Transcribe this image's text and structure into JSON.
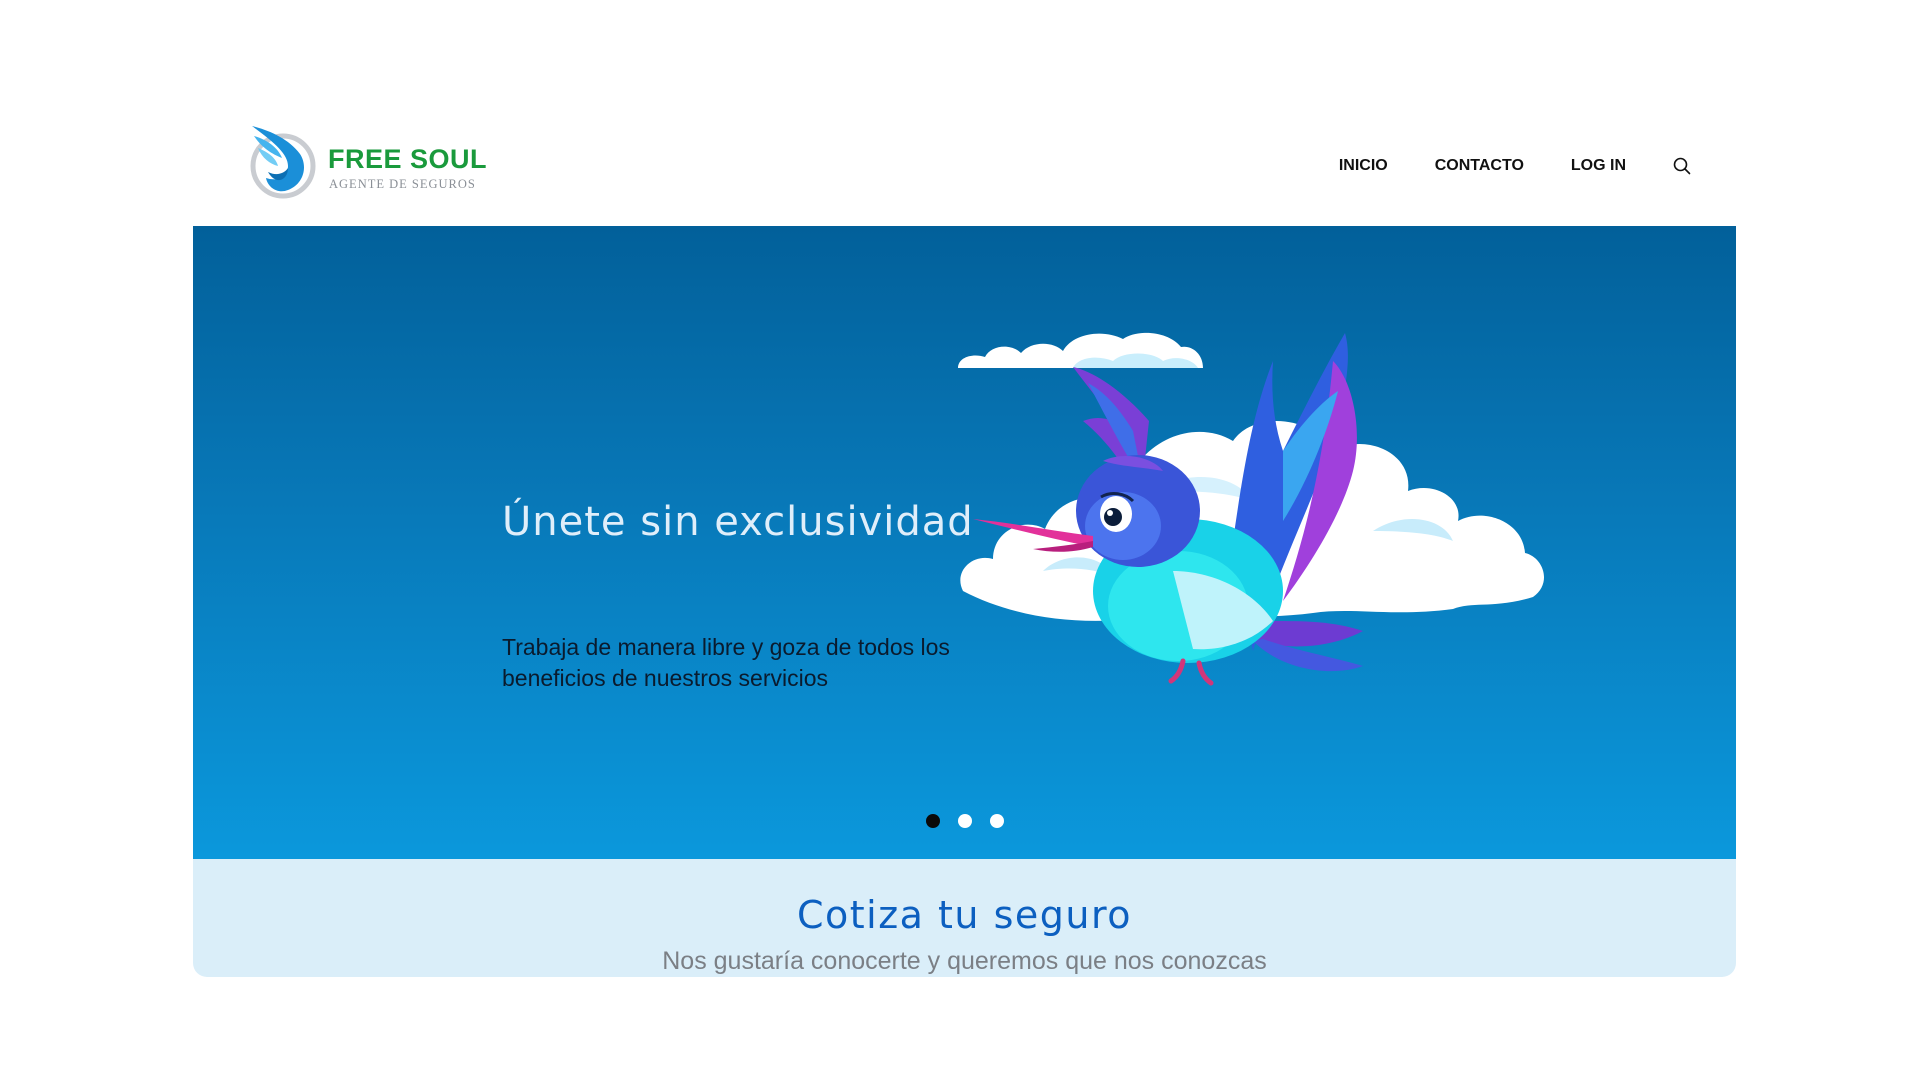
{
  "brand": {
    "name": "FREE SOUL",
    "tagline": "AGENTE DE SEGUROS",
    "color_primary": "#1a9a3c",
    "color_logo": "#1b8fd8"
  },
  "nav": {
    "items": [
      {
        "label": "INICIO"
      },
      {
        "label": "CONTACTO"
      },
      {
        "label": "LOG IN"
      }
    ],
    "search_icon": "search-icon"
  },
  "hero": {
    "title": "Únete sin exclusividad",
    "text": "Trabaja de manera libre y goza de todos los beneficios de nuestros servicios",
    "illustration": "hummingbird-with-clouds",
    "slides_total": 3,
    "active_slide": 1,
    "colors": {
      "top": "#02609a",
      "bottom": "#0b98dc"
    }
  },
  "quote": {
    "title": "Cotiza tu seguro",
    "subtitle": "Nos gustaría conocerte y queremos que nos conozcas",
    "title_color": "#0c5fc0"
  }
}
